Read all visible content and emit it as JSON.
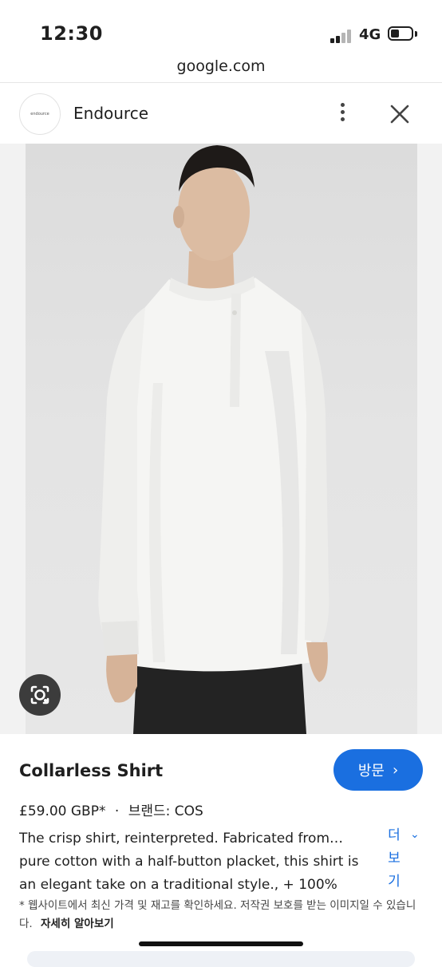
{
  "status_bar": {
    "time": "12:30",
    "network": "4G"
  },
  "browser": {
    "url": "google.com"
  },
  "header": {
    "site_name": "Endource",
    "logo_text": "endource"
  },
  "product": {
    "title": "Collarless Shirt",
    "visit_label": "방문",
    "price": "£59.00 GBP*",
    "dot": "·",
    "brand": "브랜드: COS",
    "description_line1": "The crisp shirt, reinterpreted. Fabricated from…",
    "description_rest": "pure cotton with a half-button placket, this shirt is an elegant take on a traditional style., + 100%",
    "more_label": "더 보기",
    "disclaimer": "* 웹사이트에서 최신 가격 및 재고를 확인하세요. 저작권 보호를 받는 이미지일 수 있습니다.",
    "learn_more": "자세히 알아보기"
  },
  "colors": {
    "accent": "#1a6fe0",
    "shirt": "#f4f4f2",
    "trousers": "#232323"
  }
}
